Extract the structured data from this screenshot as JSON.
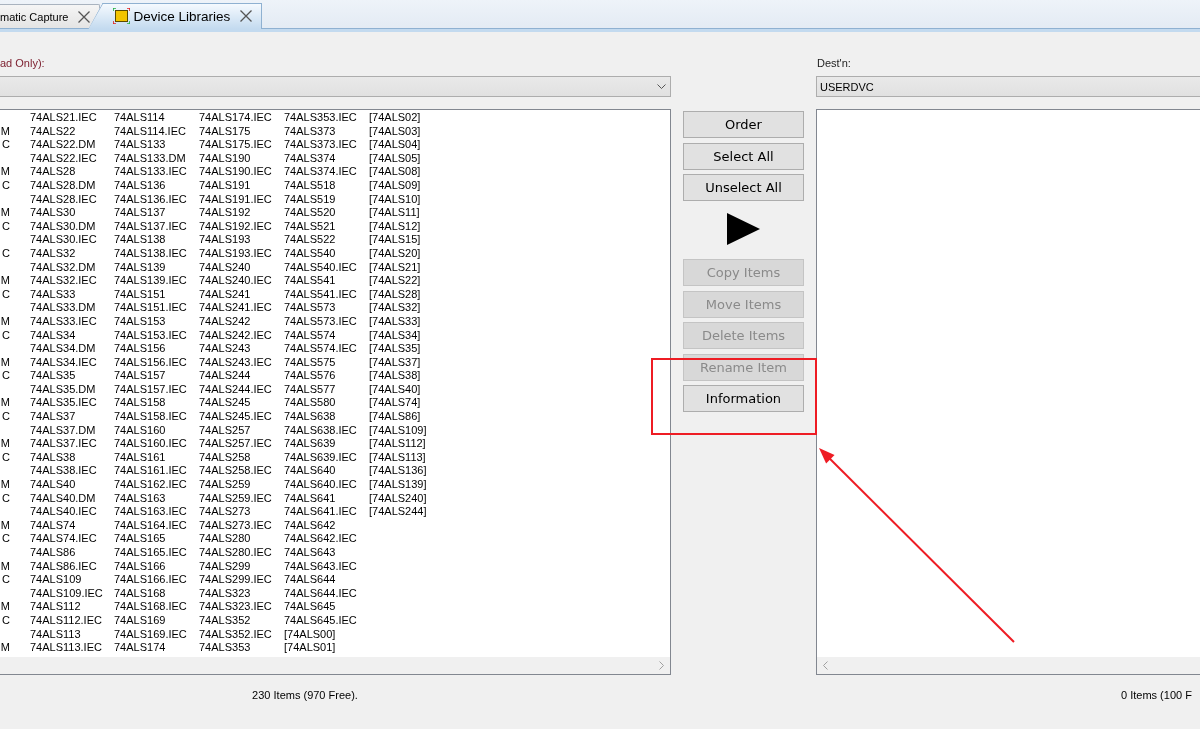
{
  "tabs": [
    {
      "label": "matic Capture",
      "selected": false,
      "icon": false
    },
    {
      "label": "Device Libraries",
      "selected": true,
      "icon": true
    }
  ],
  "source": {
    "label": "ad Only):",
    "rows": [
      {
        "column_1": "74ALS21.IEC",
        "column_2": "74ALS114",
        "column_3": "74ALS174.IEC",
        "column_4": "74ALS353.IEC",
        "column_5": "[74ALS02]"
      },
      {
        "column_0": "M",
        "column_1": "74ALS22",
        "column_2": "74ALS114.IEC",
        "column_3": "74ALS175",
        "column_4": "74ALS373",
        "column_5": "[74ALS03]"
      },
      {
        "column_0": "C",
        "column_1": "74ALS22.DM",
        "column_2": "74ALS133",
        "column_3": "74ALS175.IEC",
        "column_4": "74ALS373.IEC",
        "column_5": "[74ALS04]"
      },
      {
        "column_1": "74ALS22.IEC",
        "column_2": "74ALS133.DM",
        "column_3": "74ALS190",
        "column_4": "74ALS374",
        "column_5": "[74ALS05]"
      },
      {
        "column_0": "M",
        "column_1": "74ALS28",
        "column_2": "74ALS133.IEC",
        "column_3": "74ALS190.IEC",
        "column_4": "74ALS374.IEC",
        "column_5": "[74ALS08]"
      },
      {
        "column_0": "C",
        "column_1": "74ALS28.DM",
        "column_2": "74ALS136",
        "column_3": "74ALS191",
        "column_4": "74ALS518",
        "column_5": "[74ALS09]"
      },
      {
        "column_1": "74ALS28.IEC",
        "column_2": "74ALS136.IEC",
        "column_3": "74ALS191.IEC",
        "column_4": "74ALS519",
        "column_5": "[74ALS10]"
      },
      {
        "column_0": "M",
        "column_1": "74ALS30",
        "column_2": "74ALS137",
        "column_3": "74ALS192",
        "column_4": "74ALS520",
        "column_5": "[74ALS11]"
      },
      {
        "column_0": "C",
        "column_1": "74ALS30.DM",
        "column_2": "74ALS137.IEC",
        "column_3": "74ALS192.IEC",
        "column_4": "74ALS521",
        "column_5": "[74ALS12]"
      },
      {
        "column_1": "74ALS30.IEC",
        "column_2": "74ALS138",
        "column_3": "74ALS193",
        "column_4": "74ALS522",
        "column_5": "[74ALS15]"
      },
      {
        "column_0": "C",
        "column_1": "74ALS32",
        "column_2": "74ALS138.IEC",
        "column_3": "74ALS193.IEC",
        "column_4": "74ALS540",
        "column_5": "[74ALS20]"
      },
      {
        "column_1": "74ALS32.DM",
        "column_2": "74ALS139",
        "column_3": "74ALS240",
        "column_4": "74ALS540.IEC",
        "column_5": "[74ALS21]"
      },
      {
        "column_0": "M",
        "column_1": "74ALS32.IEC",
        "column_2": "74ALS139.IEC",
        "column_3": "74ALS240.IEC",
        "column_4": "74ALS541",
        "column_5": "[74ALS22]"
      },
      {
        "column_0": "C",
        "column_1": "74ALS33",
        "column_2": "74ALS151",
        "column_3": "74ALS241",
        "column_4": "74ALS541.IEC",
        "column_5": "[74ALS28]"
      },
      {
        "column_1": "74ALS33.DM",
        "column_2": "74ALS151.IEC",
        "column_3": "74ALS241.IEC",
        "column_4": "74ALS573",
        "column_5": "[74ALS32]"
      },
      {
        "column_0": "M",
        "column_1": "74ALS33.IEC",
        "column_2": "74ALS153",
        "column_3": "74ALS242",
        "column_4": "74ALS573.IEC",
        "column_5": "[74ALS33]"
      },
      {
        "column_0": "C",
        "column_1": "74ALS34",
        "column_2": "74ALS153.IEC",
        "column_3": "74ALS242.IEC",
        "column_4": "74ALS574",
        "column_5": "[74ALS34]"
      },
      {
        "column_1": "74ALS34.DM",
        "column_2": "74ALS156",
        "column_3": "74ALS243",
        "column_4": "74ALS574.IEC",
        "column_5": "[74ALS35]"
      },
      {
        "column_0": "M",
        "column_1": "74ALS34.IEC",
        "column_2": "74ALS156.IEC",
        "column_3": "74ALS243.IEC",
        "column_4": "74ALS575",
        "column_5": "[74ALS37]"
      },
      {
        "column_0": "C",
        "column_1": "74ALS35",
        "column_2": "74ALS157",
        "column_3": "74ALS244",
        "column_4": "74ALS576",
        "column_5": "[74ALS38]"
      },
      {
        "column_1": "74ALS35.DM",
        "column_2": "74ALS157.IEC",
        "column_3": "74ALS244.IEC",
        "column_4": "74ALS577",
        "column_5": "[74ALS40]"
      },
      {
        "column_0": "M",
        "column_1": "74ALS35.IEC",
        "column_2": "74ALS158",
        "column_3": "74ALS245",
        "column_4": "74ALS580",
        "column_5": "[74ALS74]"
      },
      {
        "column_0": "C",
        "column_1": "74ALS37",
        "column_2": "74ALS158.IEC",
        "column_3": "74ALS245.IEC",
        "column_4": "74ALS638",
        "column_5": "[74ALS86]"
      },
      {
        "column_1": "74ALS37.DM",
        "column_2": "74ALS160",
        "column_3": "74ALS257",
        "column_4": "74ALS638.IEC",
        "column_5": "[74ALS109]"
      },
      {
        "column_0": "M",
        "column_1": "74ALS37.IEC",
        "column_2": "74ALS160.IEC",
        "column_3": "74ALS257.IEC",
        "column_4": "74ALS639",
        "column_5": "[74ALS112]"
      },
      {
        "column_0": "C",
        "column_1": "74ALS38",
        "column_2": "74ALS161",
        "column_3": "74ALS258",
        "column_4": "74ALS639.IEC",
        "column_5": "[74ALS113]"
      },
      {
        "column_1": "74ALS38.IEC",
        "column_2": "74ALS161.IEC",
        "column_3": "74ALS258.IEC",
        "column_4": "74ALS640",
        "column_5": "[74ALS136]"
      },
      {
        "column_0": "M",
        "column_1": "74ALS40",
        "column_2": "74ALS162.IEC",
        "column_3": "74ALS259",
        "column_4": "74ALS640.IEC",
        "column_5": "[74ALS139]"
      },
      {
        "column_0": "C",
        "column_1": "74ALS40.DM",
        "column_2": "74ALS163",
        "column_3": "74ALS259.IEC",
        "column_4": "74ALS641",
        "column_5": "[74ALS240]"
      },
      {
        "column_1": "74ALS40.IEC",
        "column_2": "74ALS163.IEC",
        "column_3": "74ALS273",
        "column_4": "74ALS641.IEC",
        "column_5": "[74ALS244]"
      },
      {
        "column_0": "M",
        "column_1": "74ALS74",
        "column_2": "74ALS164.IEC",
        "column_3": "74ALS273.IEC",
        "column_4": "74ALS642"
      },
      {
        "column_0": "C",
        "column_1": "74ALS74.IEC",
        "column_2": "74ALS165",
        "column_3": "74ALS280",
        "column_4": "74ALS642.IEC"
      },
      {
        "column_1": "74ALS86",
        "column_2": "74ALS165.IEC",
        "column_3": "74ALS280.IEC",
        "column_4": "74ALS643"
      },
      {
        "column_0": "M",
        "column_1": "74ALS86.IEC",
        "column_2": "74ALS166",
        "column_3": "74ALS299",
        "column_4": "74ALS643.IEC"
      },
      {
        "column_0": "C",
        "column_1": "74ALS109",
        "column_2": "74ALS166.IEC",
        "column_3": "74ALS299.IEC",
        "column_4": "74ALS644"
      },
      {
        "column_1": "74ALS109.IEC",
        "column_2": "74ALS168",
        "column_3": "74ALS323",
        "column_4": "74ALS644.IEC"
      },
      {
        "column_0": "M",
        "column_1": "74ALS112",
        "column_2": "74ALS168.IEC",
        "column_3": "74ALS323.IEC",
        "column_4": "74ALS645"
      },
      {
        "column_0": "C",
        "column_1": "74ALS112.IEC",
        "column_2": "74ALS169",
        "column_3": "74ALS352",
        "column_4": "74ALS645.IEC"
      },
      {
        "column_1": "74ALS113",
        "column_2": "74ALS169.IEC",
        "column_3": "74ALS352.IEC",
        "column_4": "[74ALS00]"
      },
      {
        "column_0": "M",
        "column_1": "74ALS113.IEC",
        "column_2": "74ALS174",
        "column_3": "74ALS353",
        "column_4": "[74ALS01]"
      }
    ],
    "status": "230 Items (970 Free)."
  },
  "buttons": [
    {
      "kind": "text",
      "label": "Order",
      "disabled": false
    },
    {
      "kind": "text",
      "label": "Select All",
      "disabled": false
    },
    {
      "kind": "text",
      "label": "Unselect All",
      "disabled": false
    },
    {
      "kind": "arrow",
      "disabled": false
    },
    {
      "kind": "text",
      "label": "Copy Items",
      "disabled": true
    },
    {
      "kind": "text",
      "label": "Move Items",
      "disabled": true
    },
    {
      "kind": "text",
      "label": "Delete Items",
      "disabled": true
    },
    {
      "kind": "text",
      "label": "Rename Item",
      "disabled": true
    },
    {
      "kind": "text",
      "label": "Information",
      "disabled": false
    }
  ],
  "dest": {
    "label": "Dest'n:",
    "value": "USERDVC",
    "status": "0 Items (100 F"
  },
  "annotations": [
    {
      "kind": "highlight_box"
    },
    {
      "kind": "arrow"
    }
  ]
}
